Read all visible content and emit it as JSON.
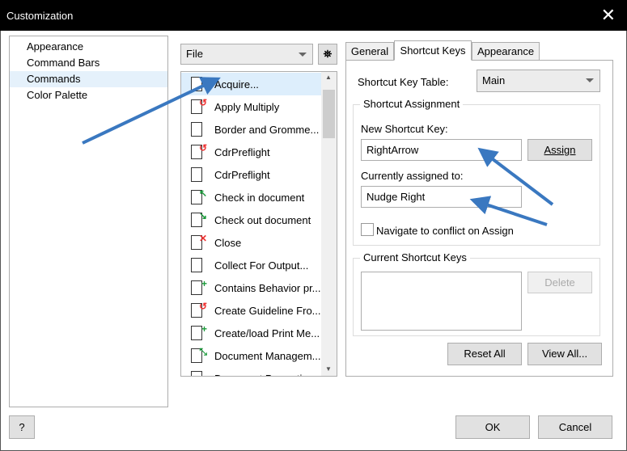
{
  "window": {
    "title": "Customization",
    "close": "✕"
  },
  "nav": [
    "Appearance",
    "Command Bars",
    "Commands",
    "Color Palette"
  ],
  "category": "File",
  "commands": [
    {
      "label": "Acquire...",
      "icon": "acquire-icon",
      "mark": "",
      "color": "#333"
    },
    {
      "label": "Apply Multiply",
      "icon": "script-icon",
      "mark": "↺",
      "color": "#e33"
    },
    {
      "label": "Border and Gromme...",
      "icon": "border-icon",
      "mark": "",
      "color": "#333"
    },
    {
      "label": "CdrPreflight",
      "icon": "script-icon",
      "mark": "↺",
      "color": "#e33"
    },
    {
      "label": "CdrPreflight",
      "icon": "page-icon",
      "mark": "",
      "color": "#333"
    },
    {
      "label": "Check in document",
      "icon": "check-in-icon",
      "mark": "↖",
      "color": "#1a9a3a"
    },
    {
      "label": "Check out document",
      "icon": "check-out-icon",
      "mark": "↘",
      "color": "#1a9a3a"
    },
    {
      "label": "Close",
      "icon": "close-doc-icon",
      "mark": "✕",
      "color": "#e33"
    },
    {
      "label": "Collect For Output...",
      "icon": "collect-icon",
      "mark": "",
      "color": "#333"
    },
    {
      "label": "Contains Behavior pr...",
      "icon": "add-page-icon",
      "mark": "+",
      "color": "#1a9a3a"
    },
    {
      "label": "Create Guideline Fro...",
      "icon": "script-icon",
      "mark": "↺",
      "color": "#e33"
    },
    {
      "label": "Create/load Print Me...",
      "icon": "add-page-icon",
      "mark": "+",
      "color": "#1a9a3a"
    },
    {
      "label": "Document Managem...",
      "icon": "doc-manage-icon",
      "mark": "⤡",
      "color": "#1a9a3a"
    },
    {
      "label": "Document Properties",
      "icon": "page-icon",
      "mark": "",
      "color": "#333"
    }
  ],
  "tabs": [
    "General",
    "Shortcut Keys",
    "Appearance"
  ],
  "shortcut": {
    "table_label": "Shortcut Key Table:",
    "table_value": "Main",
    "assignment_legend": "Shortcut Assignment",
    "new_key_label": "New Shortcut Key:",
    "new_key_value": "RightArrow",
    "assign": "Assign",
    "assigned_label": "Currently assigned to:",
    "assigned_value": "Nudge Right",
    "navigate_label": "Navigate to conflict on Assign",
    "navigate_checked": false,
    "current_legend": "Current Shortcut Keys",
    "delete": "Delete",
    "reset_all": "Reset All",
    "view_all": "View All..."
  },
  "footer": {
    "help": "?",
    "ok": "OK",
    "cancel": "Cancel"
  },
  "annotation_color": "#3a78c0"
}
